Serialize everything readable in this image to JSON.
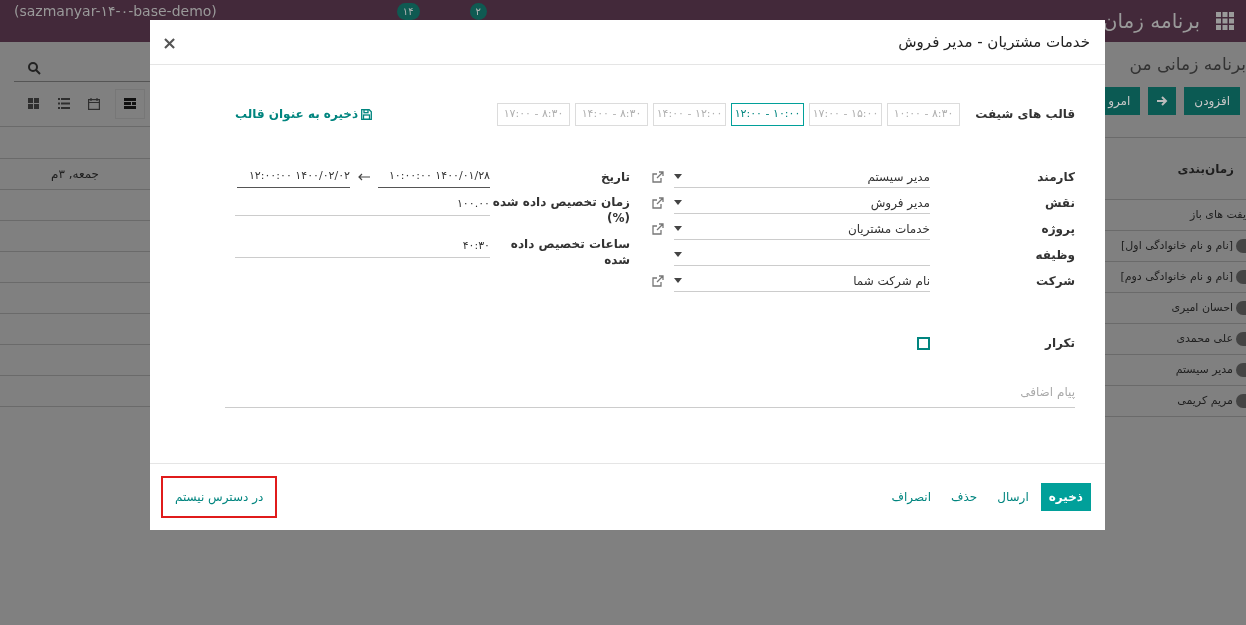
{
  "navbar": {
    "app_title": "برنامه زمان",
    "database": "(sazmanyar-۱۴-۰-base-demo)",
    "badges": [
      "۲",
      "۱۴"
    ]
  },
  "background": {
    "breadcrumb": "برنامه زمانی من",
    "buttons": [
      {
        "kind": "text",
        "label": "افزودن"
      },
      {
        "kind": "arrow"
      },
      {
        "kind": "text",
        "label": "امرو"
      }
    ],
    "views": [
      {
        "kind": "kanban",
        "selected": false
      },
      {
        "kind": "list",
        "selected": false
      },
      {
        "kind": "calendar",
        "selected": false
      },
      {
        "kind": "gantt",
        "selected": true
      }
    ],
    "gantt": {
      "row_header": "زمان‌بندی",
      "column": "جمعه, ۳م",
      "rows": [
        {
          "name": "یفت های باز",
          "avatar": false
        },
        {
          "name": "[نام و نام خانوادگی اول]",
          "avatar": true
        },
        {
          "name": "[نام و نام خانوادگی دوم]",
          "avatar": true
        },
        {
          "name": "احسان امیری",
          "avatar": true
        },
        {
          "name": "علی محمدی",
          "avatar": true
        },
        {
          "name": "مدیر سیستم",
          "avatar": true
        },
        {
          "name": "مریم کریمی",
          "avatar": true
        }
      ]
    }
  },
  "dialog": {
    "title": "خدمات مشتریان - مدیر فروش",
    "close": "×",
    "shift_templates": {
      "label": "قالب های شیفت",
      "save_link": "ذخیره به عنوان قالب",
      "items": [
        {
          "label": "۸:۳۰ - ۱۰:۰۰",
          "selected": false
        },
        {
          "label": "۱۵:۰۰ - ۱۷:۰۰",
          "selected": false
        },
        {
          "label": "۱۰:۰۰ - ۱۲:۰۰",
          "selected": true
        },
        {
          "label": "۱۲:۰۰ - ۱۴:۰۰",
          "selected": false
        },
        {
          "label": "۸:۳۰ - ۱۴:۰۰",
          "selected": false
        },
        {
          "label": "۸:۳۰ - ۱۷:۰۰",
          "selected": false
        }
      ]
    },
    "fields": [
      {
        "label": "کارمند",
        "value": "مدیر سیستم",
        "external_link": true
      },
      {
        "label": "نقش",
        "value": "مدیر فروش",
        "external_link": true
      },
      {
        "label": "پروژه",
        "value": "خدمات مشتریان",
        "external_link": true
      },
      {
        "label": "وظیفه",
        "external_link": false
      },
      {
        "label": "شرکت",
        "value": "نام شرکت شما",
        "external_link": true
      }
    ],
    "date": {
      "label": "تاریخ",
      "start": "۱۴۰۰/۰۱/۲۸ ۱۰:۰۰:۰۰",
      "end": "۱۴۰۰/۰۲/۰۲ ۱۲:۰۰:۰۰"
    },
    "allocated_percentage": {
      "label": "زمان تخصیص داده شده (%)",
      "value": "۱۰۰.۰۰"
    },
    "allocated_hours": {
      "label": "ساعات تخصیص داده شده",
      "value": "۴۰:۳۰"
    },
    "recurrence": {
      "label": "تکرار",
      "checked": false
    },
    "note": {
      "placeholder": "پیام اضافی"
    },
    "footer_buttons": [
      {
        "kind": "primary",
        "label": "ذخیره",
        "highlighted": false
      },
      {
        "kind": "link",
        "label": "ارسال",
        "highlighted": false
      },
      {
        "kind": "link",
        "label": "حذف",
        "highlighted": false
      },
      {
        "kind": "link",
        "label": "انصراف",
        "highlighted": false
      },
      {
        "kind": "link",
        "label": "در دسترس نیستم",
        "highlighted": true
      }
    ]
  }
}
